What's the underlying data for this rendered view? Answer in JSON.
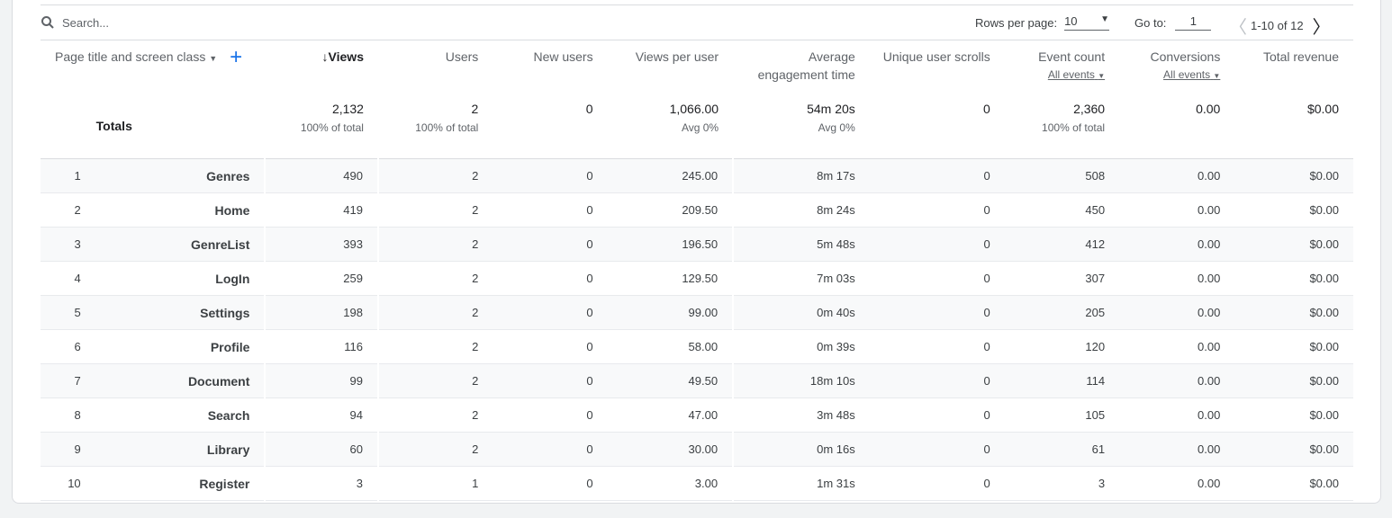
{
  "toolbar": {
    "search_placeholder": "Search...",
    "rows_per_page_label": "Rows per page:",
    "rows_per_page_value": "10",
    "goto_label": "Go to:",
    "goto_value": "1",
    "range": "1-10 of 12"
  },
  "columns": {
    "dimension": "Page title and screen class",
    "views": "Views",
    "users": "Users",
    "new_users": "New users",
    "views_per_user": "Views per user",
    "avg_engagement_1": "Average",
    "avg_engagement_2": "engagement time",
    "scrolls": "Unique user scrolls",
    "event_count": "Event count",
    "event_filter": "All events",
    "conversions": "Conversions",
    "conversions_filter": "All events",
    "revenue": "Total revenue"
  },
  "totals": {
    "label": "Totals",
    "views": "2,132",
    "views_sub": "100% of total",
    "users": "2",
    "users_sub": "100% of total",
    "new_users": "0",
    "vpu": "1,066.00",
    "vpu_sub": "Avg 0%",
    "avg": "54m 20s",
    "avg_sub": "Avg 0%",
    "scrolls": "0",
    "events": "2,360",
    "events_sub": "100% of total",
    "conv": "0.00",
    "rev": "$0.00"
  },
  "rows": [
    [
      "1",
      "Genres",
      "490",
      "2",
      "0",
      "245.00",
      "8m 17s",
      "0",
      "508",
      "0.00",
      "$0.00"
    ],
    [
      "2",
      "Home",
      "419",
      "2",
      "0",
      "209.50",
      "8m 24s",
      "0",
      "450",
      "0.00",
      "$0.00"
    ],
    [
      "3",
      "GenreList",
      "393",
      "2",
      "0",
      "196.50",
      "5m 48s",
      "0",
      "412",
      "0.00",
      "$0.00"
    ],
    [
      "4",
      "LogIn",
      "259",
      "2",
      "0",
      "129.50",
      "7m 03s",
      "0",
      "307",
      "0.00",
      "$0.00"
    ],
    [
      "5",
      "Settings",
      "198",
      "2",
      "0",
      "99.00",
      "0m 40s",
      "0",
      "205",
      "0.00",
      "$0.00"
    ],
    [
      "6",
      "Profile",
      "116",
      "2",
      "0",
      "58.00",
      "0m 39s",
      "0",
      "120",
      "0.00",
      "$0.00"
    ],
    [
      "7",
      "Document",
      "99",
      "2",
      "0",
      "49.50",
      "18m 10s",
      "0",
      "114",
      "0.00",
      "$0.00"
    ],
    [
      "8",
      "Search",
      "94",
      "2",
      "0",
      "47.00",
      "3m 48s",
      "0",
      "105",
      "0.00",
      "$0.00"
    ],
    [
      "9",
      "Library",
      "60",
      "2",
      "0",
      "30.00",
      "0m 16s",
      "0",
      "61",
      "0.00",
      "$0.00"
    ],
    [
      "10",
      "Register",
      "3",
      "1",
      "0",
      "3.00",
      "1m 31s",
      "0",
      "3",
      "0.00",
      "$0.00"
    ]
  ]
}
